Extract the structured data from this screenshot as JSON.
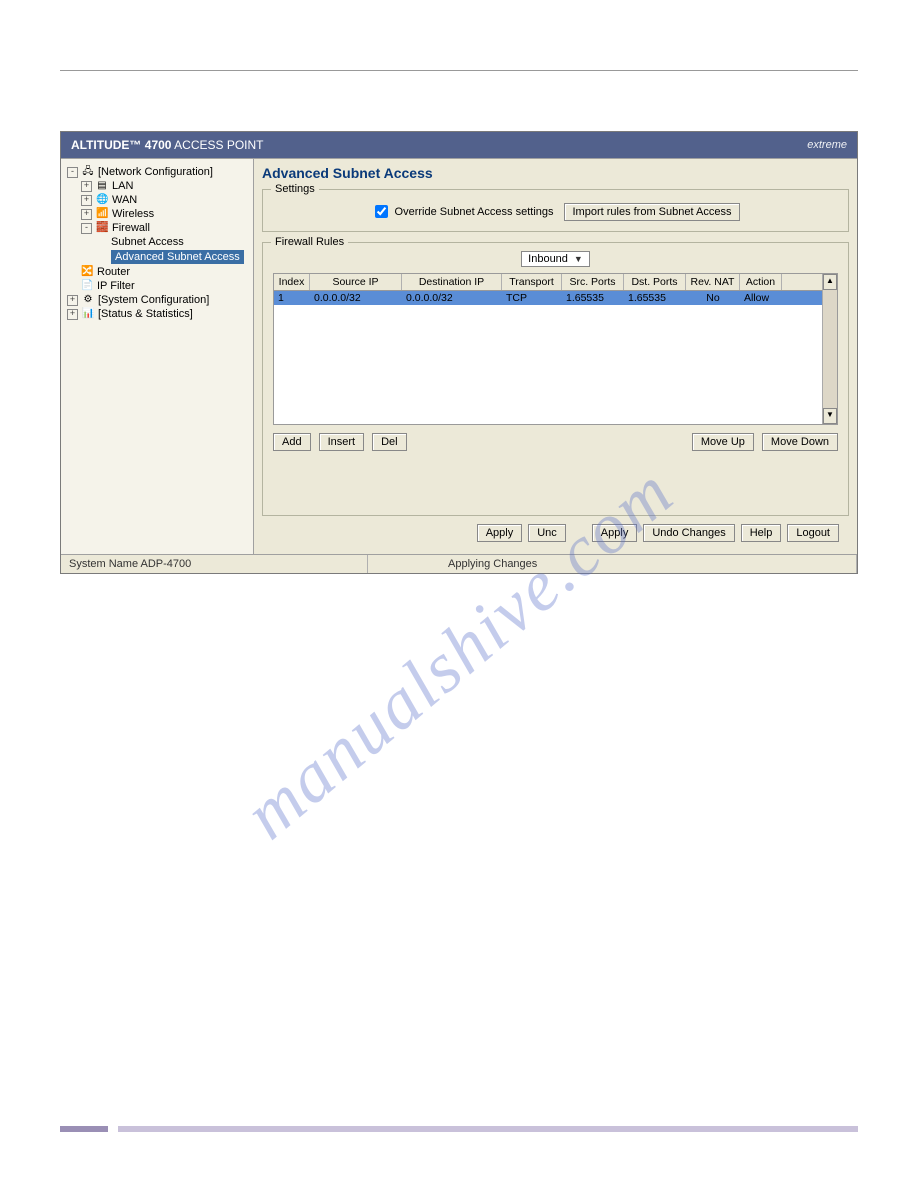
{
  "header": {
    "product_prefix": "ALTITUDE™",
    "product_model": "4700",
    "product_suffix": "ACCESS POINT",
    "brand": "extreme"
  },
  "tree": {
    "network_config": "[Network Configuration]",
    "lan": "LAN",
    "wan": "WAN",
    "wireless": "Wireless",
    "firewall": "Firewall",
    "subnet_access": "Subnet Access",
    "adv_subnet_access": "Advanced Subnet Access",
    "router": "Router",
    "ip_filter": "IP Filter",
    "system_config": "[System Configuration]",
    "status_stats": "[Status & Statistics]"
  },
  "content": {
    "title": "Advanced Subnet Access",
    "settings_legend": "Settings",
    "override_label": "Override Subnet Access settings",
    "import_btn": "Import rules from Subnet Access",
    "rules_legend": "Firewall Rules",
    "direction_value": "Inbound"
  },
  "table": {
    "headers": {
      "index": "Index",
      "source_ip": "Source IP",
      "dest_ip": "Destination IP",
      "transport": "Transport",
      "src_ports": "Src. Ports",
      "dst_ports": "Dst. Ports",
      "rev_nat": "Rev. NAT",
      "action": "Action"
    },
    "row1": {
      "index": "1",
      "source_ip": "0.0.0.0/32",
      "dest_ip": "0.0.0.0/32",
      "transport": "TCP",
      "src_ports": "1.65535",
      "dst_ports": "1.65535",
      "rev_nat": "No",
      "action": "Allow"
    }
  },
  "buttons": {
    "add": "Add",
    "insert": "Insert",
    "del": "Del",
    "move_up": "Move Up",
    "move_down": "Move Down",
    "apply": "Apply",
    "undo_short": "Unc",
    "undo_changes": "Undo Changes",
    "help": "Help",
    "logout": "Logout"
  },
  "status": {
    "system_name": "System Name ADP-4700",
    "applying": "Applying Changes"
  },
  "watermark": "manualshive.com"
}
